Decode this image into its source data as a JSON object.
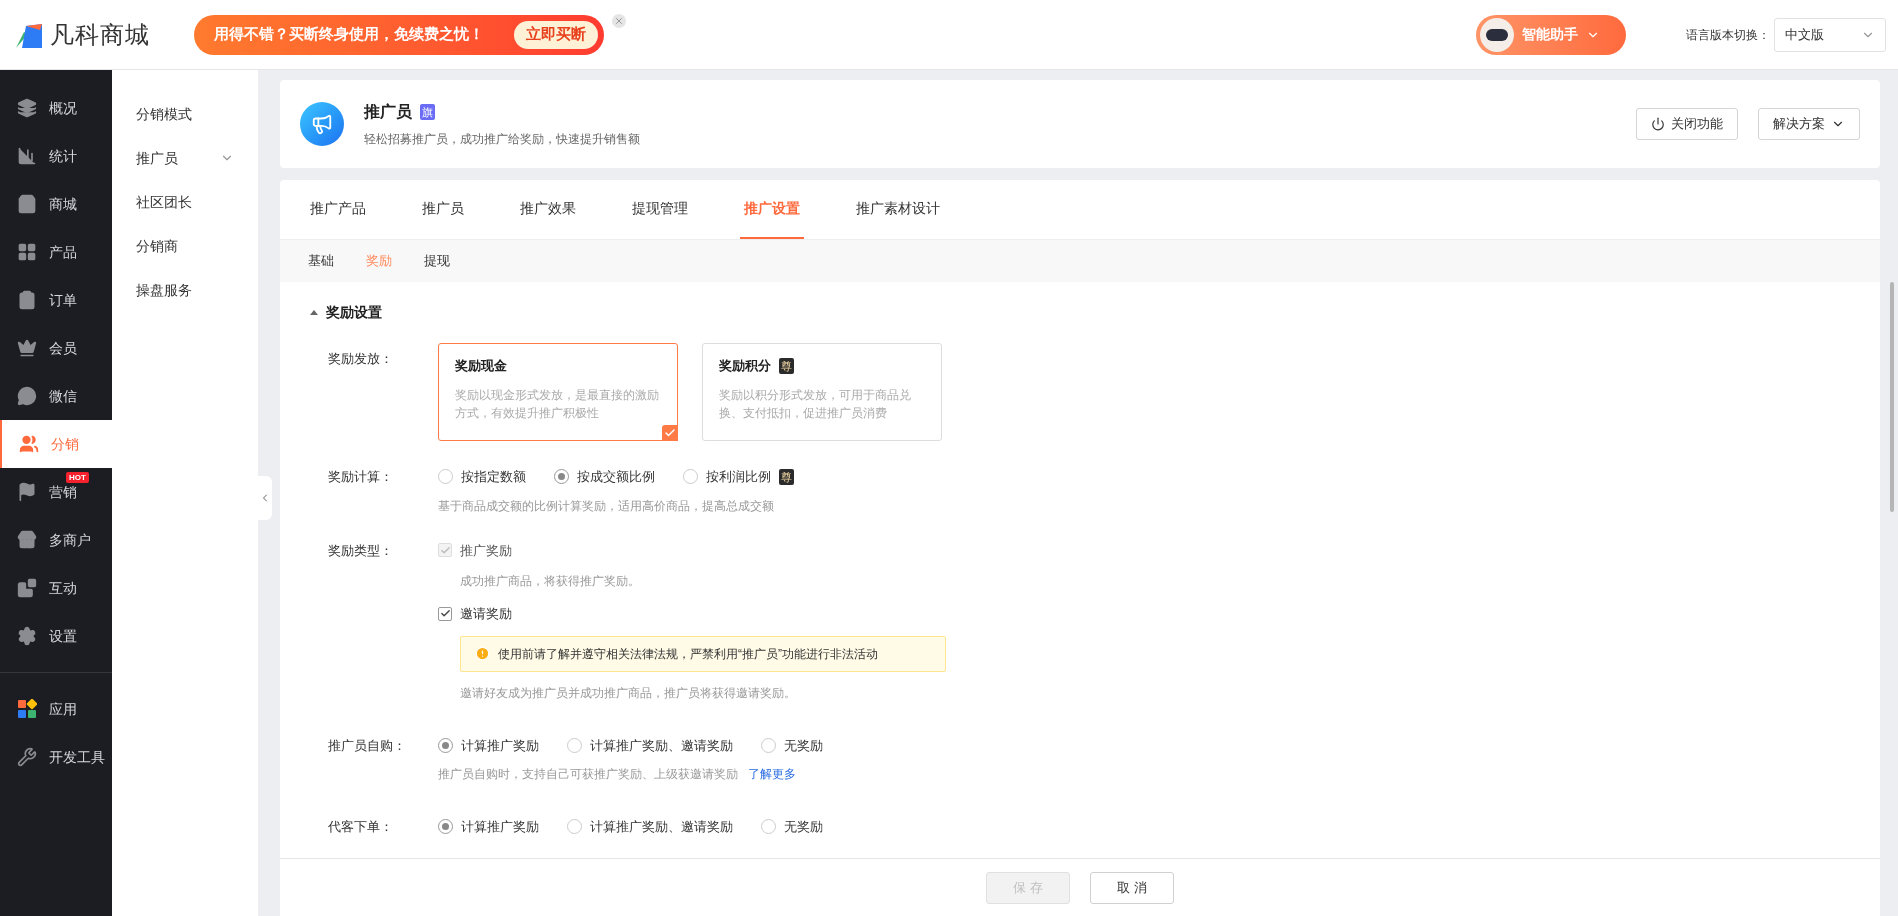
{
  "brand": {
    "name": "凡科商城"
  },
  "banner": {
    "text": "用得不错？买断终身使用，免续费之忧！",
    "button": "立即买断"
  },
  "assistant": {
    "label": "智能助手"
  },
  "language": {
    "label": "语言版本切换：",
    "value": "中文版"
  },
  "main_nav": [
    {
      "label": "概况",
      "selected": false
    },
    {
      "label": "统计",
      "selected": false
    },
    {
      "label": "商城",
      "selected": false
    },
    {
      "label": "产品",
      "selected": false
    },
    {
      "label": "订单",
      "selected": false
    },
    {
      "label": "会员",
      "selected": false
    },
    {
      "label": "微信",
      "selected": false
    },
    {
      "label": "分销",
      "selected": true
    },
    {
      "label": "营销",
      "selected": false,
      "badge": "HOT"
    },
    {
      "label": "多商户",
      "selected": false
    },
    {
      "label": "互动",
      "selected": false
    },
    {
      "label": "设置",
      "selected": false
    }
  ],
  "bottom_nav": [
    {
      "label": "应用",
      "selected": false
    },
    {
      "label": "开发工具",
      "selected": false
    }
  ],
  "sub_nav": [
    {
      "label": "分销模式",
      "kind": "link"
    },
    {
      "label": "推广员",
      "kind": "group"
    },
    {
      "label": "社区团长",
      "kind": "link"
    },
    {
      "label": "分销商",
      "kind": "link"
    },
    {
      "label": "操盘服务",
      "kind": "link"
    }
  ],
  "header": {
    "title": "推广员",
    "badge": "旗",
    "subtitle": "轻松招募推广员，成功推广给奖励，快速提升销售额",
    "buttons": [
      "关闭功能",
      "解决方案"
    ]
  },
  "tabs": [
    {
      "label": "推广产品",
      "selected": false
    },
    {
      "label": "推广员",
      "selected": false
    },
    {
      "label": "推广效果",
      "selected": false
    },
    {
      "label": "提现管理",
      "selected": false
    },
    {
      "label": "推广设置",
      "selected": true
    },
    {
      "label": "推广素材设计",
      "selected": false
    }
  ],
  "sub_tabs": [
    {
      "label": "基础",
      "selected": false
    },
    {
      "label": "奖励",
      "selected": true
    },
    {
      "label": "提现",
      "selected": false
    }
  ],
  "section": {
    "title": "奖励设置"
  },
  "payout": {
    "label": "奖励发放：",
    "options": [
      {
        "title": "奖励现金",
        "description": "奖励以现金形式发放，是最直接的激励方式，有效提升推广积极性",
        "selected": true
      },
      {
        "title": "奖励积分",
        "badge": "尊",
        "description": "奖励以积分形式发放，可用于商品兑换、支付抵扣，促进推广员消费",
        "selected": false
      }
    ]
  },
  "calculation": {
    "label": "奖励计算：",
    "options": [
      {
        "label": "按指定数额",
        "selected": false
      },
      {
        "label": "按成交额比例",
        "selected": true
      },
      {
        "label": "按利润比例",
        "badge": "尊",
        "selected": false
      }
    ],
    "hint": "基于商品成交额的比例计算奖励，适用高价商品，提高总成交额"
  },
  "reward_types": {
    "label": "奖励类型：",
    "items": [
      {
        "label": "推广奖励",
        "checked": true,
        "disabled": true,
        "hint": "成功推广商品，将获得推广奖励。"
      },
      {
        "label": "邀请奖励",
        "checked": true,
        "disabled": false,
        "warning": "使用前请了解并遵守相关法律法规，严禁利用“推广员”功能进行非法活动",
        "hint": "邀请好友成为推广员并成功推广商品，推广员将获得邀请奖励。"
      }
    ]
  },
  "self_purchase": {
    "label": "推广员自购：",
    "options": [
      {
        "label": "计算推广奖励",
        "selected": true
      },
      {
        "label": "计算推广奖励、邀请奖励",
        "selected": false
      },
      {
        "label": "无奖励",
        "selected": false
      }
    ],
    "hint": "推广员自购时，支持自己可获推广奖励、上级获邀请奖励",
    "link": "了解更多"
  },
  "proxy_order": {
    "label": "代客下单：",
    "options": [
      {
        "label": "计算推广奖励",
        "selected": true
      },
      {
        "label": "计算推广奖励、邀请奖励",
        "selected": false
      },
      {
        "label": "无奖励",
        "selected": false
      }
    ]
  },
  "footer": {
    "buttons": [
      {
        "label": "保 存",
        "disabled": true
      },
      {
        "label": "取 消",
        "disabled": false
      }
    ]
  }
}
